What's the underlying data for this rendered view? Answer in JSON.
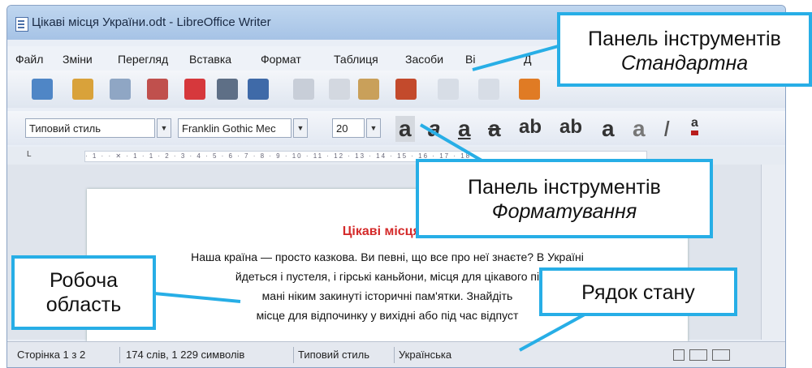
{
  "window": {
    "title": "Цікаві місця України.odt - LibreOffice Writer"
  },
  "menu": [
    "Файл",
    "Зміни",
    "Перегляд",
    "Вставка",
    "Формат",
    "Таблиця",
    "Засоби",
    "Ві",
    "Д"
  ],
  "formatting_toolbar": {
    "style_value": "Типовий стиль",
    "font_value": "Franklin Gothic Mec",
    "size_value": "20",
    "glyphs": [
      "a",
      "a",
      "a",
      "a",
      "ab",
      "ab",
      "a",
      "a",
      "I",
      "a"
    ]
  },
  "ruler": {
    "text": "· 1 · · ✕ · 1 · 1 · 2 · 3 · 4 · 5 · 6 · 7 · 8 · 9 · 10 · 11 · 12 · 13 · 14 · 15 · 16 · 17 · 18 ·"
  },
  "document": {
    "title": "Цікаві місця У",
    "lines": [
      "Наша країна — просто казкова. Ви певні, що все про неї знаєте? В Україні",
      "йдеться і пустеля, і гірські каньйони, місця для цікавого пі",
      "мані ніким закинуті історичні пам'ятки. Знайдіть",
      "місце для відпочинку у вихідні або під час відпуст"
    ]
  },
  "statusbar": {
    "page": "Сторінка 1 з 2",
    "words": "174 слів, 1 229 символів",
    "style": "Типовий стиль",
    "language": "Українська"
  },
  "callouts": {
    "standard": {
      "line1": "Панель інструментів",
      "line2": "Стандартна"
    },
    "formatting": {
      "line1": "Панель інструментів",
      "line2": "Форматування"
    },
    "workarea": {
      "line1": "Робоча",
      "line2": "область"
    },
    "status": {
      "line1": "Рядок стану"
    }
  },
  "colors": {
    "callout_border": "#27aee6",
    "doc_title": "#d42a2a",
    "titlebar": "#a6c3e6"
  }
}
